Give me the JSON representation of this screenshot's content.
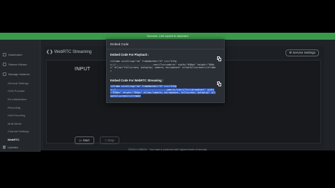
{
  "toast": {
    "text": "Success: Link copied to clipboard"
  },
  "sidebar": {
    "items": [
      {
        "label": "Dashboard"
      },
      {
        "label": "Stream Wizard"
      },
      {
        "label": "Manage Instance"
      }
    ],
    "sub_items": [
      {
        "label": "General Settings"
      },
      {
        "label": "CDN Provider"
      },
      {
        "label": "Re-Initialization"
      },
      {
        "label": "Recording"
      },
      {
        "label": "Unit Encoding"
      },
      {
        "label": "Multi-Mode"
      },
      {
        "label": "Channel Settings"
      },
      {
        "label": "WebRTC"
      }
    ],
    "bottom": {
      "label": "Updates"
    }
  },
  "header": {
    "title": "WebRTC Streaming",
    "settings_button": "Service Settings"
  },
  "panel": {
    "input_label": "INPUT",
    "start_button": "Start",
    "stop_button": "Stop"
  },
  "footer": {
    "text": "©2024 LIVEBOX · Your data is protected with highest levels of security"
  },
  "modal": {
    "title": "Embed Code",
    "playback_title": "Embed Code For Playback :",
    "playback_code": "<iframe scrolling=\"no\" frameborder=\"0\" src=\"https://...........................cast/?src=webrtc\" width=\"640px\" height=\"360px\" allow=\"fullscreen; autoplay; camera; microphone\" allowfullscreen></iframe>",
    "streaming_title": "Embed Code For WebRTC Streaming :",
    "streaming_code": "<iframe scrolling=\"no\" frameborder=\"0\" src=\"https://.....................................webrtc/start/?src=broadcast\" width=\"640px\" height=\"360px\" allow=\"camera; microphone; fullscreen; autoplay\" allowfullscreen></iframe>"
  }
}
